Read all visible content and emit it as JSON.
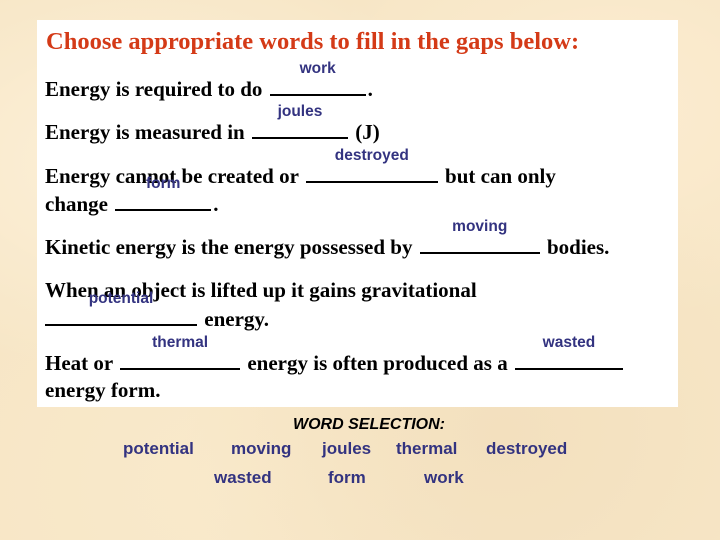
{
  "title": "Choose appropriate words to fill in the gaps below:",
  "sentences": [
    {
      "before": "Energy is required to do",
      "answer": "work",
      "after": "."
    },
    {
      "before": "Energy is measured in",
      "answer": "joules",
      "after": "(J)"
    },
    {
      "before": "Energy cannot be created or",
      "answer": "destroyed",
      "after": "but can only"
    },
    {
      "before": "change",
      "answer": "form",
      "after": "."
    },
    {
      "before": "Kinetic energy is the energy possessed by",
      "answer": "moving",
      "after": "bodies."
    },
    {
      "before": "When an object is lifted up it gains gravitational",
      "answer": "",
      "after": ""
    },
    {
      "before": "",
      "answer": "potential",
      "after": "energy."
    },
    {
      "before": "Heat or",
      "answer": "thermal",
      "middle": "energy is often produced as a",
      "answer2": "wasted",
      "after": ""
    },
    {
      "before": "energy form.",
      "answer": "",
      "after": ""
    }
  ],
  "word_selection": {
    "title": "WORD SELECTION:",
    "words": [
      "potential",
      "moving",
      "joules",
      "thermal",
      "destroyed",
      "wasted",
      "form",
      "work"
    ]
  },
  "colors": {
    "title": "#d43a17",
    "answer": "#333380",
    "card": "#ffffff",
    "background": "#f7e6c6"
  }
}
